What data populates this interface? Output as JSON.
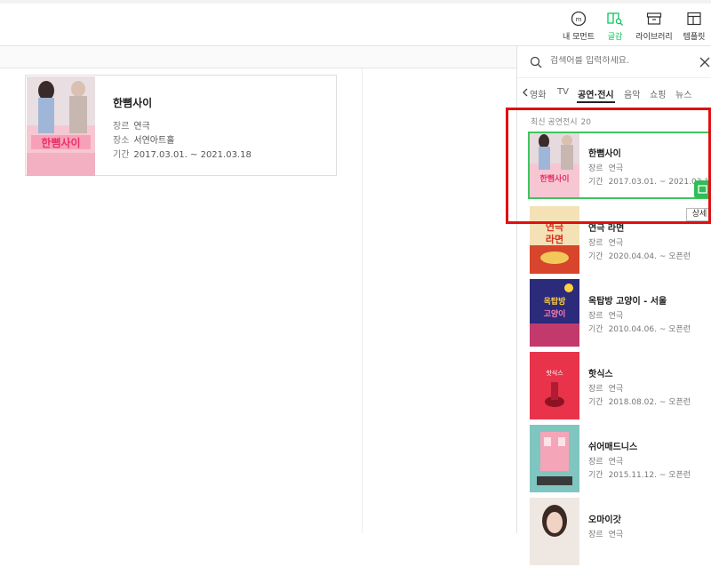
{
  "toolbar": {
    "items": [
      {
        "label": "내 모먼트",
        "icon": "moment-icon"
      },
      {
        "label": "글감",
        "icon": "book-search-icon"
      },
      {
        "label": "라이브러리",
        "icon": "archive-icon"
      },
      {
        "label": "템플릿",
        "icon": "template-icon"
      }
    ],
    "accent_color": "#03c75a"
  },
  "editor": {
    "card": {
      "title": "한뼘사이",
      "genre_label": "장르",
      "genre_value": "연극",
      "place_label": "장소",
      "place_value": "서연아트홀",
      "period_label": "기간",
      "period_value": "2017.03.01. ~ 2021.03.18"
    }
  },
  "panel": {
    "search": {
      "placeholder": "검색어를 입력하세요."
    },
    "tabs": [
      "영화",
      "TV",
      "공연·전시",
      "음악",
      "쇼핑",
      "뉴스"
    ],
    "active_tab": "공연·전시",
    "list_heading": "최신 공연전시",
    "list_count": "20",
    "detail_button": "상세",
    "items": [
      {
        "title": "한뼘사이",
        "genre_label": "장르",
        "genre": "연극",
        "period_label": "기간",
        "period": "2017.03.01. ~ 2021.03.18"
      },
      {
        "title": "연극 라면",
        "genre_label": "장르",
        "genre": "연극",
        "period_label": "기간",
        "period": "2020.04.04. ~ 오픈런"
      },
      {
        "title": "옥탑방 고양이 - 서울",
        "genre_label": "장르",
        "genre": "연극",
        "period_label": "기간",
        "period": "2010.04.06. ~ 오픈런"
      },
      {
        "title": "핫식스",
        "genre_label": "장르",
        "genre": "연극",
        "period_label": "기간",
        "period": "2018.08.02. ~ 오픈런"
      },
      {
        "title": "쉬어매드니스",
        "genre_label": "장르",
        "genre": "연극",
        "period_label": "기간",
        "period": "2015.11.12. ~ 오픈런"
      },
      {
        "title": "오마이갓",
        "genre_label": "장르",
        "genre": "연극",
        "period_label": "",
        "period": ""
      }
    ]
  }
}
